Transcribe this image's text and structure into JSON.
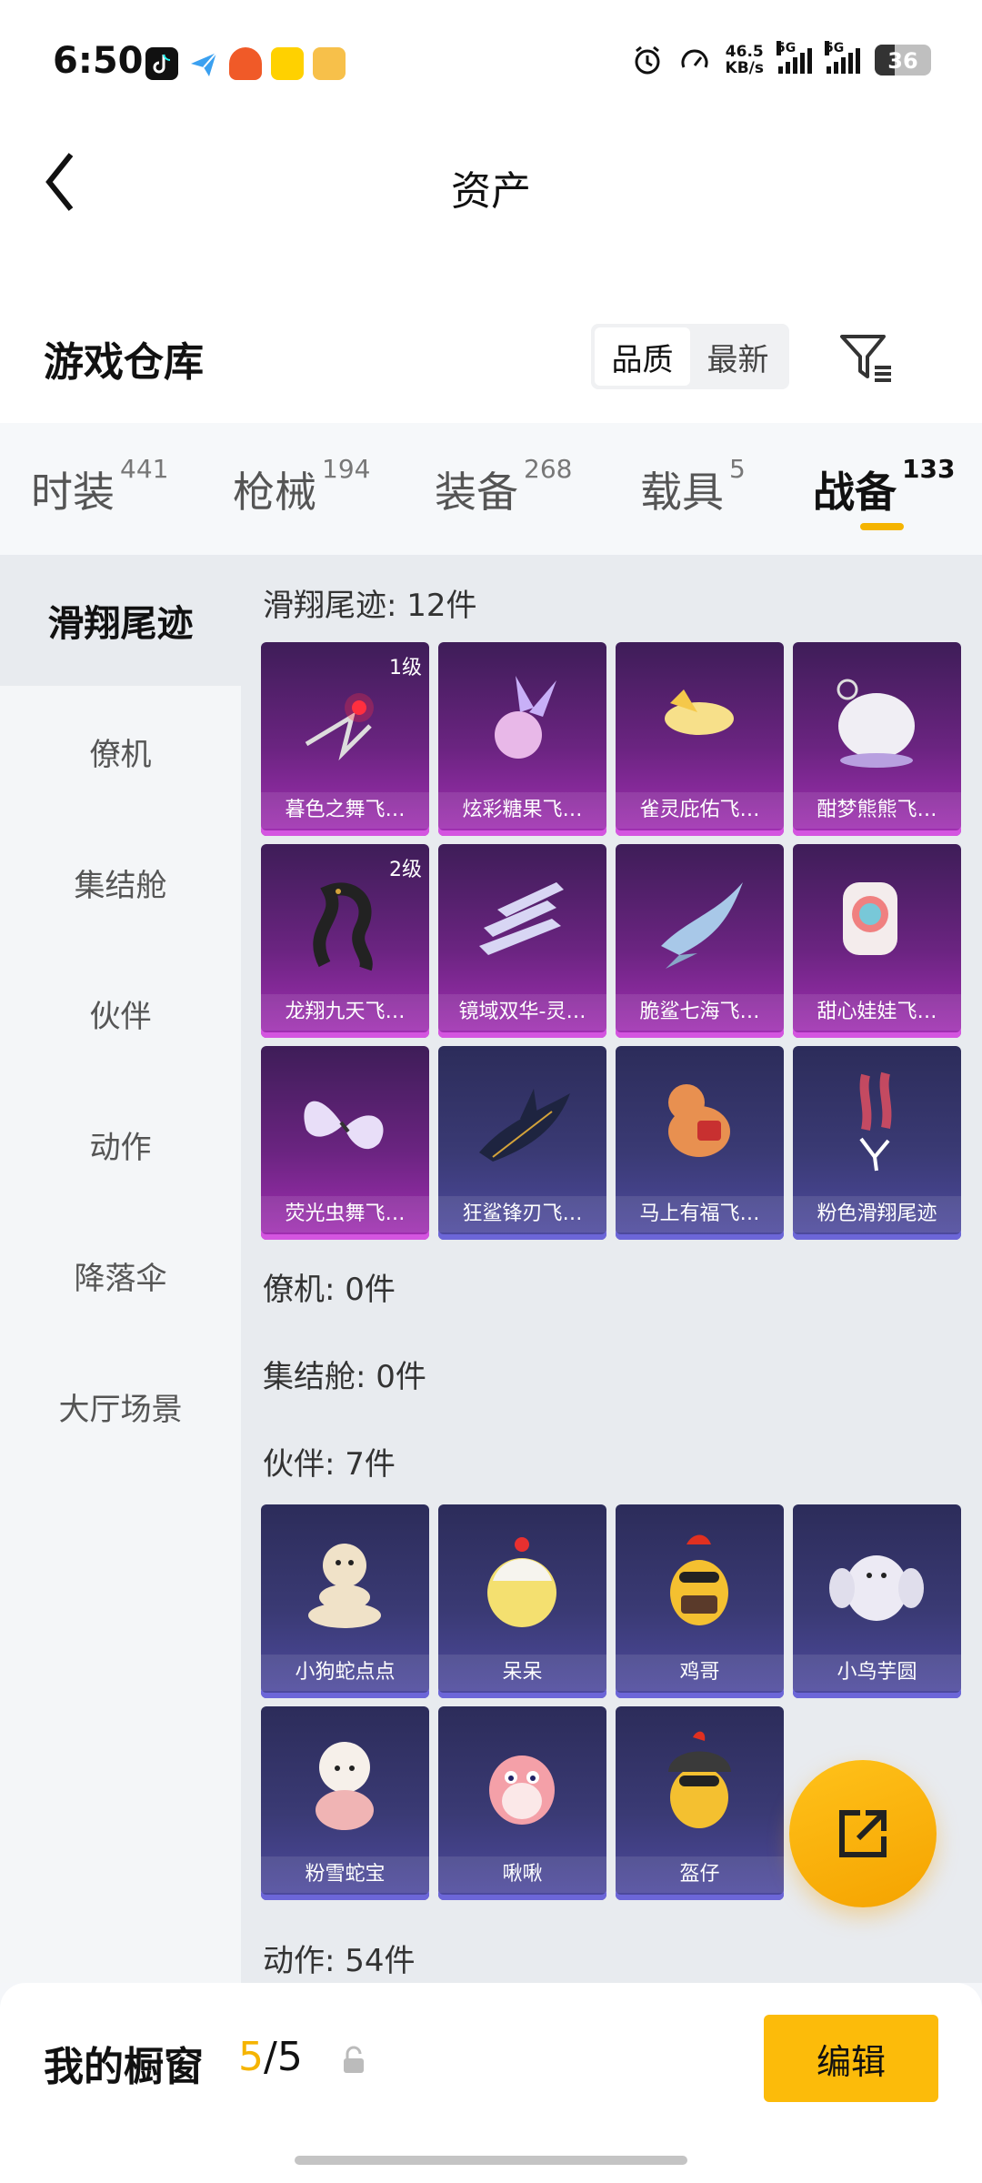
{
  "status_bar": {
    "time": "6:50",
    "net_speed": "46.5",
    "net_unit": "KB/s",
    "sig1_label": "5G",
    "sig2_label": "5G",
    "battery": "36",
    "battery_level": 0.36,
    "apps": [
      "tiktok-icon",
      "paper-plane-icon",
      "app-icon",
      "meituan-icon",
      "deals-icon"
    ]
  },
  "header": {
    "title": "资产"
  },
  "warehouse": {
    "title": "游戏仓库",
    "sort_options": [
      "品质",
      "最新"
    ],
    "sort_active": "品质"
  },
  "tabs": [
    {
      "label": "时装",
      "count": "441"
    },
    {
      "label": "枪械",
      "count": "194"
    },
    {
      "label": "装备",
      "count": "268"
    },
    {
      "label": "载具",
      "count": "5"
    },
    {
      "label": "战备",
      "count": "133"
    }
  ],
  "active_tab": "战备",
  "side_nav": [
    "滑翔尾迹",
    "僚机",
    "集结舱",
    "伙伴",
    "动作",
    "降落伞",
    "大厅场景"
  ],
  "active_side": "滑翔尾迹",
  "sections": {
    "glide_title": "滑翔尾迹: 12件",
    "glide_items": [
      {
        "name": "暮色之舞飞…",
        "level": "1级",
        "rarity": "purple"
      },
      {
        "name": "炫彩糖果飞…",
        "level": "",
        "rarity": "purple"
      },
      {
        "name": "雀灵庇佑飞…",
        "level": "",
        "rarity": "purple"
      },
      {
        "name": "酣梦熊熊飞…",
        "level": "",
        "rarity": "purple"
      },
      {
        "name": "龙翔九天飞…",
        "level": "2级",
        "rarity": "purple"
      },
      {
        "name": "镜域双华-灵…",
        "level": "",
        "rarity": "purple"
      },
      {
        "name": "脆鲨七海飞…",
        "level": "",
        "rarity": "purple"
      },
      {
        "name": "甜心娃娃飞…",
        "level": "",
        "rarity": "purple"
      },
      {
        "name": "荧光虫舞飞…",
        "level": "",
        "rarity": "purple"
      },
      {
        "name": "狂鲨锋刃飞…",
        "level": "",
        "rarity": "blue"
      },
      {
        "name": "马上有福飞…",
        "level": "",
        "rarity": "blue"
      },
      {
        "name": "粉色滑翔尾迹",
        "level": "",
        "rarity": "blue"
      }
    ],
    "wingman_title": "僚机: 0件",
    "rally_title": "集结舱: 0件",
    "partner_title": "伙伴: 7件",
    "partner_items": [
      {
        "name": "小狗蛇点点",
        "rarity": "blue"
      },
      {
        "name": "呆呆",
        "rarity": "blue"
      },
      {
        "name": "鸡哥",
        "rarity": "blue"
      },
      {
        "name": "小鸟芋圆",
        "rarity": "blue"
      },
      {
        "name": "粉雪蛇宝",
        "rarity": "blue"
      },
      {
        "name": "啾啾",
        "rarity": "blue"
      },
      {
        "name": "盔仔",
        "rarity": "blue"
      }
    ],
    "action_title": "动作: 54件"
  },
  "bottom_bar": {
    "vitrine_label": "我的橱窗",
    "vitrine_current": "5",
    "vitrine_sep": "/",
    "vitrine_total": "5",
    "edit_label": "编辑"
  },
  "colors": {
    "accent": "#f5b400",
    "purple_rarity": "#a32fb4",
    "blue_rarity": "#4e4aa0"
  }
}
